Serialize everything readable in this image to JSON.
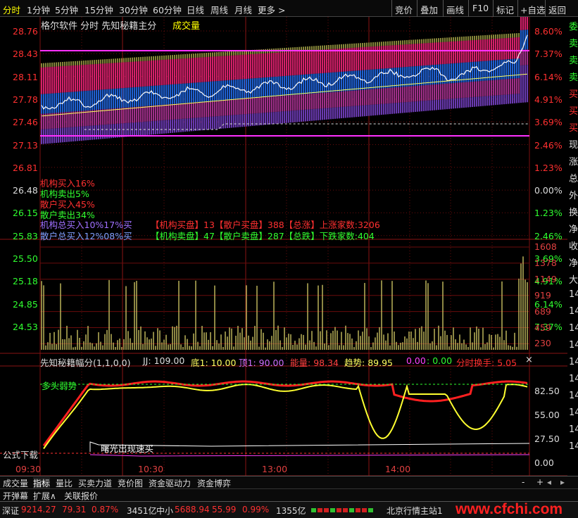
{
  "tabs": {
    "period": [
      "分时",
      "1分钟",
      "5分钟",
      "15分钟",
      "30分钟",
      "60分钟",
      "日线",
      "周线",
      "月线",
      "更多 >"
    ],
    "right": [
      "竞价",
      "叠加",
      "画线",
      "F10",
      "标记",
      "+自选",
      "返回"
    ]
  },
  "header": {
    "title": "格尔软件  分时 先知秘籍主分",
    "volume_label": "成交量"
  },
  "price_axis": {
    "left": [
      "28.76",
      "28.43",
      "28.11",
      "27.78",
      "27.46",
      "27.13",
      "26.81",
      "26.48",
      "26.15",
      "25.83",
      "25.50",
      "25.18",
      "24.85",
      "24.53"
    ],
    "right": [
      "8.60%",
      "7.37%",
      "6.14%",
      "4.91%",
      "3.69%",
      "2.46%",
      "1.23%",
      "0.00%",
      "1.23%",
      "2.46%",
      "3.69%",
      "4.91%",
      "6.14%",
      "7.37%"
    ]
  },
  "indicators": {
    "inst_buy": "机构买入16%",
    "inst_sell": "机构卖出5%",
    "retail_buy": "散户买入45%",
    "retail_sell": "散户卖出34%",
    "row1": "机构总买入10%17%买",
    "row1b": "【机构买盘】13【散户买盘】388【总涨】上涨家数:3206",
    "row2": "散户总买入12%08%买",
    "row2b": "【机构卖盘】47【散户卖盘】287【总跌】下跌家数:404"
  },
  "volume_axis": [
    "1608",
    "1378",
    "1149",
    "919",
    "689",
    "459",
    "230"
  ],
  "formula_bar": {
    "name": "先知秘籍幅分(1,1,0,0)",
    "jj_label": "JJ:",
    "jj": "109.00",
    "di_label": "底1:",
    "di": "10.00",
    "ding_label": "顶1:",
    "ding": "90.00",
    "energy_label": "能量:",
    "energy": "98.34",
    "trend_label": "趋势:",
    "trend": "89.95",
    "v1": "0.00",
    "v2": "0.00",
    "turnover_label": "分时换手",
    "turnover": "5.05"
  },
  "lower": {
    "duotou": "多头弱势",
    "signal": "曙光出现速买",
    "formula_dl": "公式下载",
    "axis": [
      "82.50",
      "55.00",
      "27.50",
      "0.00"
    ]
  },
  "time_axis": [
    "09:30",
    "10:30",
    "13:00",
    "14:00"
  ],
  "bottom_tabs": [
    "成交量",
    "指标",
    "量比",
    "买卖力道",
    "竞价图",
    "资金驱动力",
    "资金博弈"
  ],
  "bottom_tabs2": [
    "开弹幕",
    "扩展∧",
    "关联报价"
  ],
  "status": {
    "sz_label": "深证",
    "sz_value": "9214.27",
    "sz_change": "79.31",
    "sz_pct": "0.87%",
    "sz_amount": "3451亿",
    "zx_label": "中小",
    "zx_value": "5688.94",
    "zx_change": "55.99",
    "zx_pct": "0.99%",
    "zx_amount": "1355亿",
    "site": "北京行情主站1"
  },
  "watermark": "www.cfchi.com",
  "sidebar": [
    "委",
    "卖",
    "卖",
    "卖",
    "买",
    "买",
    "买",
    "现",
    "涨",
    "总",
    "外",
    "换",
    "净",
    "收",
    "净",
    "大",
    "14",
    "14",
    "14",
    "14",
    "14",
    "14",
    "14",
    "14",
    "14",
    "14"
  ]
}
